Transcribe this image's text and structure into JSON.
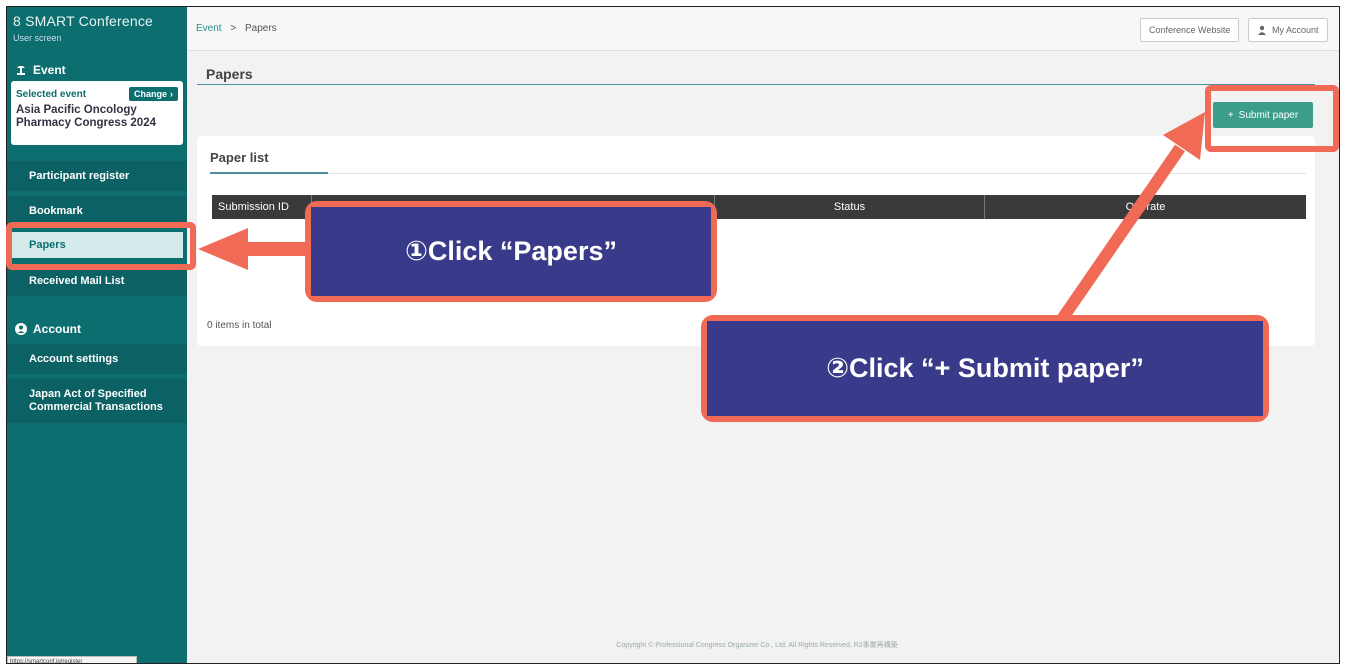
{
  "brand": {
    "title": "SMART Conference",
    "subtitle": "User screen"
  },
  "sidebar": {
    "event_heading": "Event",
    "selected_label": "Selected event",
    "change_label": "Change",
    "event_name": "Asia Pacific Oncology Pharmacy Congress 2024",
    "items": [
      {
        "label": "Participant register"
      },
      {
        "label": "Bookmark"
      },
      {
        "label": "Papers"
      },
      {
        "label": "Received Mail List"
      }
    ],
    "account_heading": "Account",
    "account_items": [
      {
        "label": "Account settings"
      },
      {
        "label": "Japan Act of Specified Commercial Transactions"
      }
    ]
  },
  "breadcrumb": {
    "root": "Event",
    "sep": ">",
    "current": "Papers"
  },
  "topbar": {
    "conference_website": "Conference Website",
    "my_account": "My Account"
  },
  "main": {
    "title": "Papers",
    "submit_label": "Submit paper",
    "card_title": "Paper list",
    "columns": [
      "Submission ID",
      "",
      "Status",
      "Operate"
    ],
    "columns_visible": [
      "Submission ID",
      "Status",
      "erate"
    ],
    "total": "0 items in total"
  },
  "footer": "Copyright © Professional Congress Organizer Co., Ltd. All Rights Reserved. R2事業再構築",
  "statusbar": "https://smartconf.jp/register",
  "annotations": {
    "step1": "①Click “Papers”",
    "step2": "②Click “+ Submit paper”",
    "accent_color": "#f06a55",
    "callout_color": "#3a3a8a"
  }
}
